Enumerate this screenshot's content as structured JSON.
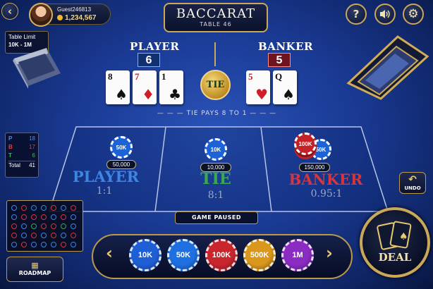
{
  "game": {
    "title": "BACCARAT",
    "table": "TABLE 46"
  },
  "player_profile": {
    "username": "Guest246813",
    "balance": "1,234,567"
  },
  "table_limit": {
    "label": "Table Limit",
    "value": "10K - 1M"
  },
  "controls": {
    "back_icon": "chevron-left-icon",
    "help_label": "?",
    "sound_icon": "speaker-icon",
    "settings_icon": "gear-icon"
  },
  "hands": {
    "player": {
      "label": "PLAYER",
      "score": "6",
      "cards": [
        {
          "rank": "8",
          "suit": "♠"
        },
        {
          "rank": "7",
          "suit": "♦"
        },
        {
          "rank": "1",
          "suit": "♣"
        }
      ]
    },
    "banker": {
      "label": "BANKER",
      "score": "5",
      "cards": [
        {
          "rank": "5",
          "suit": "♥"
        },
        {
          "rank": "Q",
          "suit": "♠"
        }
      ]
    }
  },
  "tie_badge": "TIE",
  "tie_pays": "TIE PAYS 8 TO 1",
  "stats": {
    "p_label": "P",
    "p_value": "18",
    "b_label": "B",
    "b_value": "17",
    "t_label": "T",
    "t_value": "6",
    "total_label": "Total",
    "total_value": "41"
  },
  "bet_zones": {
    "player": {
      "label": "PLAYER",
      "payout": "1:1",
      "chip": "50K",
      "amount": "50,000"
    },
    "tie": {
      "label": "TIE",
      "payout": "8:1",
      "chip": "10K",
      "amount": "10,000"
    },
    "banker": {
      "label": "BANKER",
      "payout": "0.95:1",
      "chip_front": "100K",
      "chip_back": "50K",
      "amount": "150,000"
    }
  },
  "status": "GAME PAUSED",
  "roadmap_label": "ROADMAP",
  "chips": [
    {
      "label": "10K",
      "color": "#1f5fd6"
    },
    {
      "label": "50K",
      "color": "#1e6fe0"
    },
    {
      "label": "100K",
      "color": "#c9252c"
    },
    {
      "label": "500K",
      "color": "#d9971b"
    },
    {
      "label": "1M",
      "color": "#8a2bc2"
    }
  ],
  "undo_label": "UNDO",
  "deal_label": "DEAL",
  "colors": {
    "player": "#3d86e6",
    "banker": "#d8333b",
    "tie": "#3aa84f",
    "gold": "#c9a85a"
  }
}
